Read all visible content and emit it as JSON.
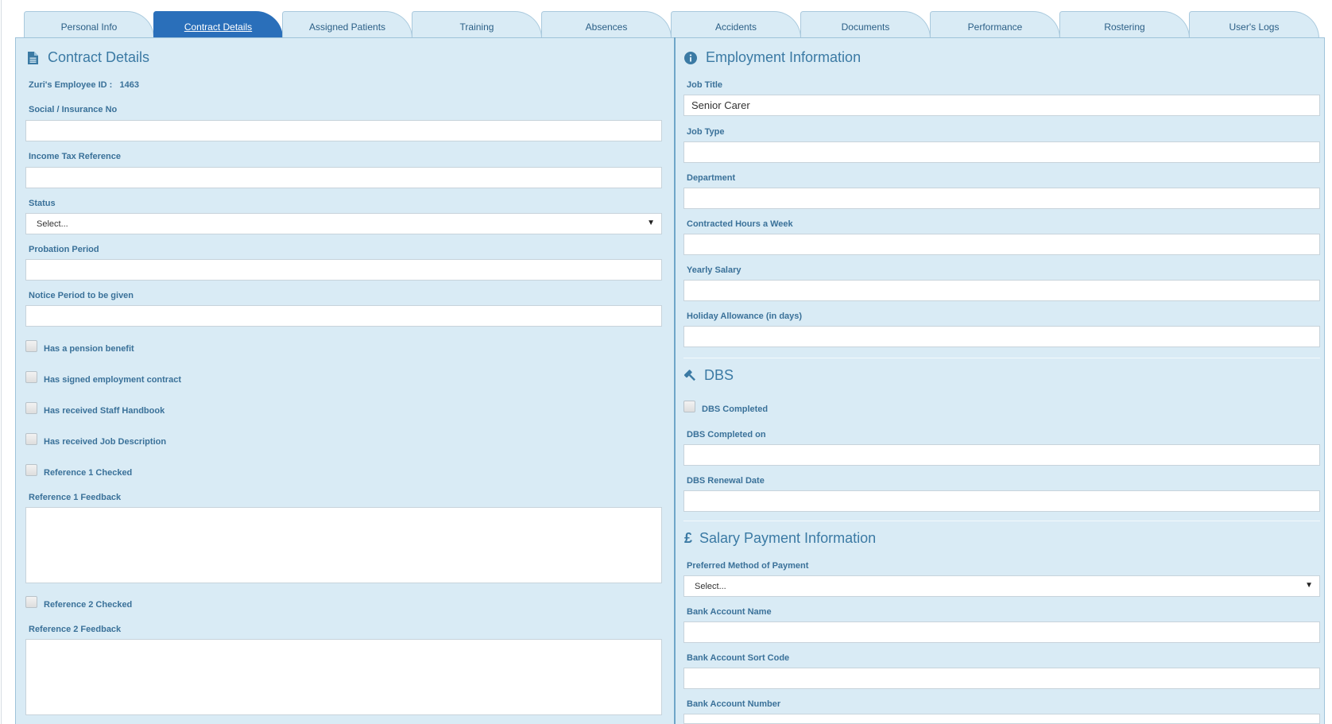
{
  "tabs": [
    {
      "label": "Personal Info",
      "active": false
    },
    {
      "label": "Contract Details",
      "active": true
    },
    {
      "label": "Assigned Patients",
      "active": false
    },
    {
      "label": "Training",
      "active": false
    },
    {
      "label": "Absences",
      "active": false
    },
    {
      "label": "Accidents",
      "active": false
    },
    {
      "label": "Documents",
      "active": false
    },
    {
      "label": "Performance",
      "active": false
    },
    {
      "label": "Rostering",
      "active": false
    },
    {
      "label": "User's Logs",
      "active": false
    }
  ],
  "contract": {
    "title": "Contract Details",
    "title_icon": "document-icon",
    "employee_id_label": "Zuri's Employee ID :",
    "employee_id_value": "1463",
    "social_label": "Social / Insurance No",
    "social_value": "",
    "tax_label": "Income Tax Reference",
    "tax_value": "",
    "status_label": "Status",
    "status_value": "Select...",
    "probation_label": "Probation Period",
    "probation_value": "",
    "notice_label": "Notice Period to be given",
    "notice_value": "",
    "pension_label": "Has a pension benefit",
    "signed_label": "Has signed employment contract",
    "handbook_label": "Has received Staff Handbook",
    "jobdesc_label": "Has received Job Description",
    "ref1_checked_label": "Reference 1 Checked",
    "ref1_feedback_label": "Reference 1 Feedback",
    "ref2_checked_label": "Reference 2 Checked",
    "ref2_feedback_label": "Reference 2 Feedback"
  },
  "employment": {
    "title": "Employment Information",
    "title_icon": "info-circle-icon",
    "job_title_label": "Job Title",
    "job_title_value": "Senior Carer",
    "job_type_label": "Job Type",
    "job_type_value": "",
    "department_label": "Department",
    "department_value": "",
    "hours_label": "Contracted Hours a Week",
    "hours_value": "",
    "salary_label": "Yearly Salary",
    "salary_value": "",
    "holiday_label": "Holiday Allowance (in days)",
    "holiday_value": ""
  },
  "dbs": {
    "title": "DBS",
    "title_icon": "gavel-icon",
    "completed_label": "DBS Completed",
    "completed_on_label": "DBS Completed on",
    "completed_on_value": "",
    "renewal_label": "DBS Renewal Date",
    "renewal_value": ""
  },
  "salary_payment": {
    "title": "Salary Payment Information",
    "title_icon": "pound-icon",
    "method_label": "Preferred Method of Payment",
    "method_value": "Select...",
    "account_name_label": "Bank Account Name",
    "account_name_value": "",
    "sort_code_label": "Bank Account Sort Code",
    "sort_code_value": "",
    "account_number_label": "Bank Account Number",
    "account_number_value": ""
  },
  "colors": {
    "panel_bg": "#d9ebf5",
    "active_tab": "#2a6fba",
    "label_text": "#3a7199",
    "divider": "#6fa6c8"
  }
}
